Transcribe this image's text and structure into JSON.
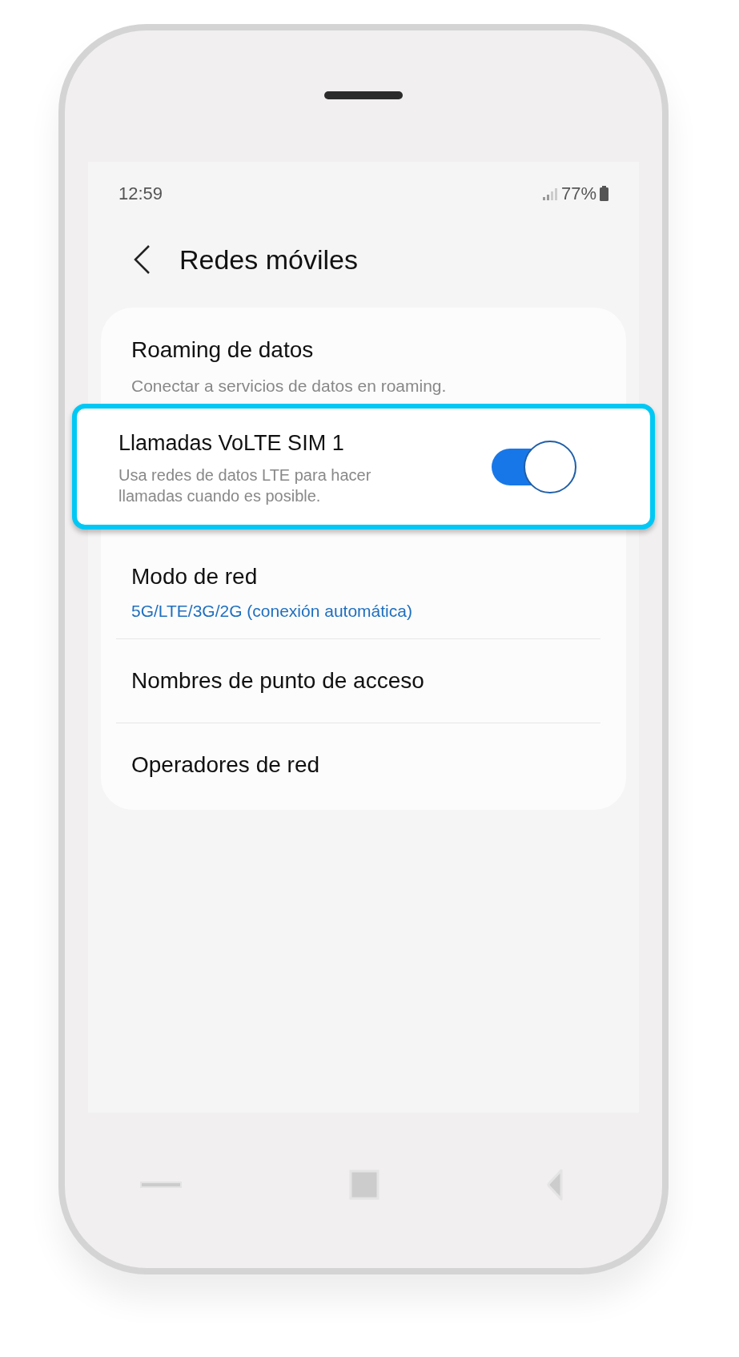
{
  "status_bar": {
    "time": "12:59",
    "battery": "77%"
  },
  "header": {
    "title": "Redes móviles"
  },
  "settings": [
    {
      "kind": "plain",
      "title": "Roaming de datos",
      "subtitle": "Conectar a servicios de datos en roaming.",
      "highlighted": false
    },
    {
      "kind": "toggle",
      "title": "Llamadas VoLTE SIM 1",
      "subtitle": "Usa redes de datos LTE para hacer llamadas cuando es posible.",
      "on": true,
      "highlighted": true
    },
    {
      "kind": "value",
      "title": "Modo de red",
      "value": "5G/LTE/3G/2G (conexión automática)",
      "highlighted": false
    },
    {
      "kind": "plain",
      "title": "Nombres de punto de acceso",
      "highlighted": false
    },
    {
      "kind": "plain",
      "title": "Operadores de red",
      "highlighted": false
    }
  ]
}
